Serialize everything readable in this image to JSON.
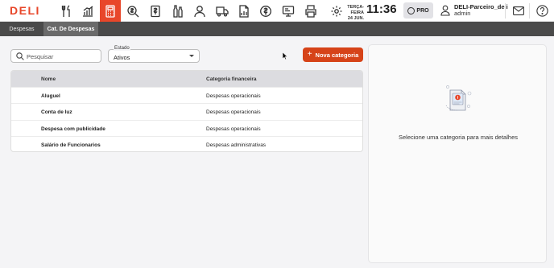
{
  "brand": {
    "logo": "DELI"
  },
  "nav_icons": [
    "utensils-icon",
    "chart-icon",
    "calculator-icon",
    "search-money-icon",
    "wallet-icon",
    "bottles-icon",
    "user-icon",
    "truck-icon",
    "report-icon",
    "coin-icon",
    "pos-icon",
    "printer-icon"
  ],
  "header": {
    "weekday": "TERÇA-FEIRA",
    "date": "24 JUN.",
    "time": "11:36",
    "plan": "PRO",
    "user_name": "DELI-Parceiro_deli",
    "user_role": "admin"
  },
  "tabs": [
    {
      "label": "Despesas",
      "active": false
    },
    {
      "label": "Cat. De Despesas",
      "active": true
    }
  ],
  "filters": {
    "search_placeholder": "Pesquisar",
    "status_label": "Estado",
    "status_value": "Ativos"
  },
  "actions": {
    "add_category": "Nova categoria"
  },
  "table": {
    "columns": [
      "Nome",
      "Categoria financeira"
    ],
    "rows": [
      {
        "name": "Aluguel",
        "category": "Despesas operacionais"
      },
      {
        "name": "Conta de luz",
        "category": "Despesas operacionais"
      },
      {
        "name": "Despesa com publicidade",
        "category": "Despesas operacionais"
      },
      {
        "name": "Salário de Funcionarios",
        "category": "Despesas administrativas"
      }
    ]
  },
  "detail": {
    "empty_message": "Selecione uma categoria para mais detalhes"
  },
  "colors": {
    "accent": "#e8472a",
    "button": "#d64318",
    "tabbar": "#4a4a4a"
  }
}
